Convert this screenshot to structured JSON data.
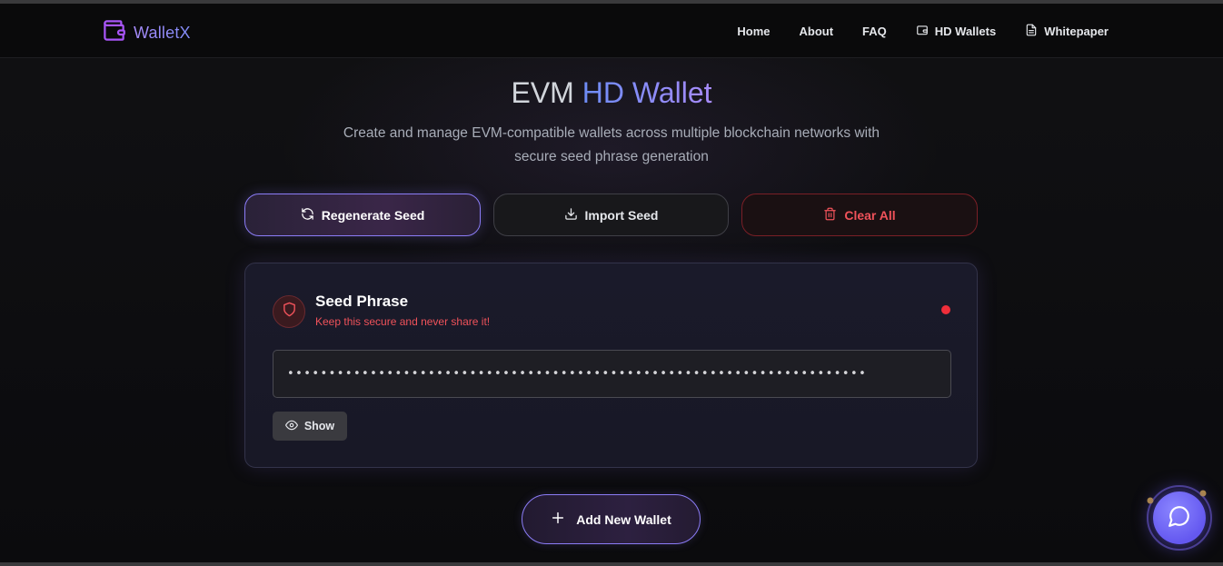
{
  "nav": {
    "brand": "WalletX",
    "links": [
      {
        "label": "Home",
        "icon": null
      },
      {
        "label": "About",
        "icon": null
      },
      {
        "label": "FAQ",
        "icon": null
      },
      {
        "label": "HD Wallets",
        "icon": "wallet-icon"
      },
      {
        "label": "Whitepaper",
        "icon": "document-icon"
      }
    ]
  },
  "hero": {
    "title_prefix": "EVM ",
    "title_highlight": "HD Wallet",
    "subtitle": "Create and manage EVM-compatible wallets across multiple blockchain networks with secure seed phrase generation"
  },
  "actions": {
    "regenerate_label": "Regenerate Seed",
    "import_label": "Import Seed",
    "clear_label": "Clear All"
  },
  "seed_card": {
    "title": "Seed Phrase",
    "warning": "Keep this secure and never share it!",
    "masked_value": "••••••••••••••••••••••••••••••••••••••••••••••••••••••••••••••••••••••",
    "show_label": "Show"
  },
  "add_wallet": {
    "label": "Add New Wallet"
  },
  "colors": {
    "accent": "#8b7cf6",
    "danger": "#f0525a",
    "background": "#0c0c0e"
  }
}
